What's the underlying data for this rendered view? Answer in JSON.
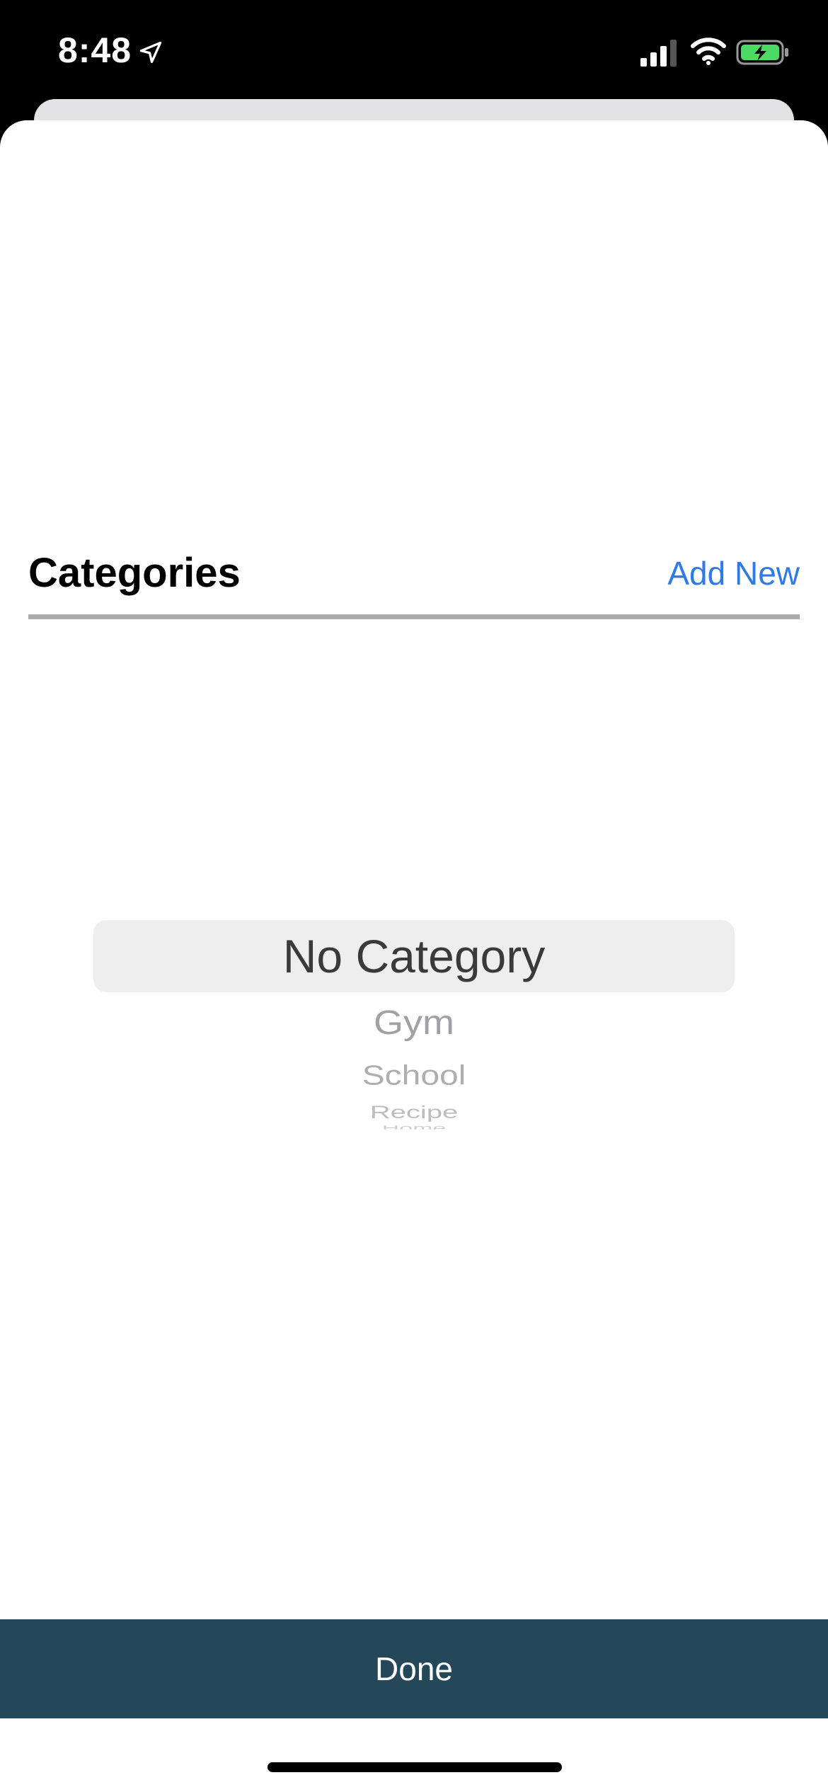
{
  "status_bar": {
    "time": "8:48",
    "icons": [
      "location-arrow-icon",
      "cellular-signal-icon",
      "wifi-icon",
      "battery-charging-icon"
    ],
    "battery_color": "#4cd964"
  },
  "header": {
    "title": "Categories",
    "add_new_label": "Add New"
  },
  "picker": {
    "selected": "No Category",
    "items": [
      "Gym",
      "School",
      "Recipe",
      "Home"
    ]
  },
  "footer": {
    "done_label": "Done"
  },
  "colors": {
    "accent": "#2f7ae5",
    "done_bar": "#24485a"
  }
}
